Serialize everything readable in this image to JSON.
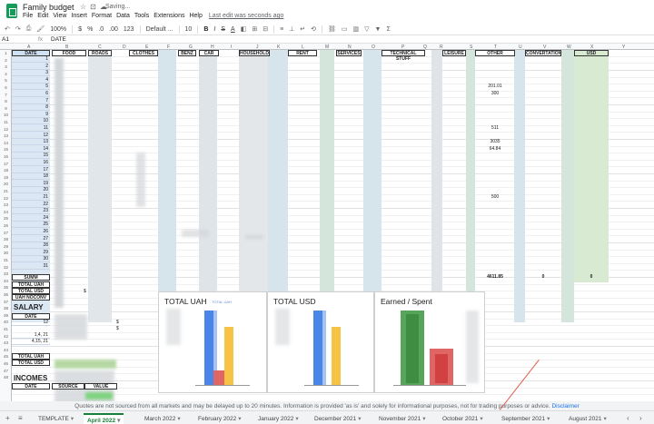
{
  "app": {
    "title": "Family budget",
    "saving_status": "Saving...",
    "menu": [
      "File",
      "Edit",
      "View",
      "Insert",
      "Format",
      "Data",
      "Tools",
      "Extensions",
      "Help"
    ],
    "last_edit": "Last edit was seconds ago"
  },
  "toolbar": {
    "zoom": "100%",
    "currency": "$",
    "percent": "%",
    "decimals_down": ".0",
    "decimals_up": ".00",
    "number_format": "123",
    "font": "Default ...",
    "font_size": "10",
    "bold": "B",
    "italic": "I",
    "strike": "S",
    "text_color": "A"
  },
  "formula_bar": {
    "name_box": "A1",
    "fx": "fx",
    "value": "DATE"
  },
  "columns": {
    "letters": [
      "A",
      "B",
      "C",
      "D",
      "E",
      "F",
      "G",
      "H",
      "I",
      "J",
      "K",
      "L",
      "M",
      "N",
      "O",
      "P",
      "Q",
      "R",
      "S",
      "T",
      "U",
      "V",
      "W",
      "X",
      "Y"
    ],
    "headers": [
      "DATE",
      "FOOD",
      "ROADS",
      "CLOTHES",
      "BENZ",
      "CAR",
      "HOUSEHOLD",
      "RENT",
      "SERVICES",
      "TECHNICAL STUFF",
      "LEISURE",
      "OTHER",
      "CONVERTATION",
      "USD"
    ]
  },
  "rows": {
    "numbers": [
      1,
      2,
      3,
      4,
      5,
      6,
      7,
      8,
      9,
      10,
      11,
      12,
      13,
      14,
      15,
      16,
      17,
      18,
      19,
      20,
      21,
      22,
      23,
      24,
      25,
      26,
      27,
      28,
      29,
      30,
      31,
      32,
      33,
      34,
      35,
      36,
      37,
      38,
      39,
      40,
      41,
      42,
      43,
      44,
      45,
      46,
      47,
      48
    ],
    "dates": [
      1,
      2,
      3,
      4,
      5,
      6,
      7,
      8,
      9,
      10,
      11,
      12,
      13,
      14,
      15,
      16,
      17,
      18,
      19,
      20,
      21,
      22,
      23,
      24,
      25,
      26,
      27,
      28,
      29,
      30,
      31
    ],
    "other_values": [
      {
        "day": 5,
        "value": "201.01"
      },
      {
        "day": 6,
        "value": "300"
      },
      {
        "day": 11,
        "value": "511"
      },
      {
        "day": 13,
        "value": "3035"
      },
      {
        "day": 14,
        "value": "64.84"
      },
      {
        "day": 21,
        "value": "500"
      }
    ]
  },
  "summary": {
    "summ_label": "SUMM",
    "total_uah_label": "TOTAL UAH",
    "total_usd_label": "TOTAL USD",
    "uah_noconv_label": "UAH NOCONV",
    "other_sum": "4611.85",
    "conv_sum": "0",
    "usd_sum": "0",
    "dollar": "$"
  },
  "salary": {
    "title": "SALARY",
    "date_header": "DATE",
    "dates": [
      "12",
      "",
      "1,4, 21",
      "4,15, 21"
    ],
    "total_uah_label": "TOTAL UAH",
    "total_usd_label": "TOTAL USD"
  },
  "incomes": {
    "title": "INCOMES",
    "headers": [
      "DATE",
      "SOURCE",
      "VALUE"
    ]
  },
  "charts": [
    {
      "title": "TOTAL UAH",
      "subtitle": "TOTAL UAH"
    },
    {
      "title": "TOTAL USD"
    },
    {
      "title": "Earned / Spent"
    }
  ],
  "disclaimer": {
    "text": "Quotes are not sourced from all markets and may be delayed up to 20 minutes. Information is provided 'as is' and solely for informational purposes, not for trading purposes or advice.",
    "link": "Disclaimer"
  },
  "tabs": {
    "add": "+",
    "all_sheets": "≡",
    "items": [
      {
        "label": "TEMPLATE",
        "active": false
      },
      {
        "label": "April 2022",
        "active": true
      },
      {
        "label": "March 2022",
        "active": false
      },
      {
        "label": "February 2022",
        "active": false
      },
      {
        "label": "January 2022",
        "active": false
      },
      {
        "label": "December 2021",
        "active": false
      },
      {
        "label": "November 2021",
        "active": false
      },
      {
        "label": "October 2021",
        "active": false
      },
      {
        "label": "September 2021",
        "active": false
      },
      {
        "label": "August 2021",
        "active": false
      }
    ]
  },
  "colors": {
    "accent_green": "#188038",
    "header_blue": "#cfe2f3",
    "band_blue": "#d7e6f2",
    "band_green": "#d9ead3",
    "bar_blue": "#4a86e8",
    "bar_yellow": "#f6c344",
    "bar_red": "#e06666",
    "bar_green": "#57a55a",
    "annotation_red": "#e25b4f"
  }
}
